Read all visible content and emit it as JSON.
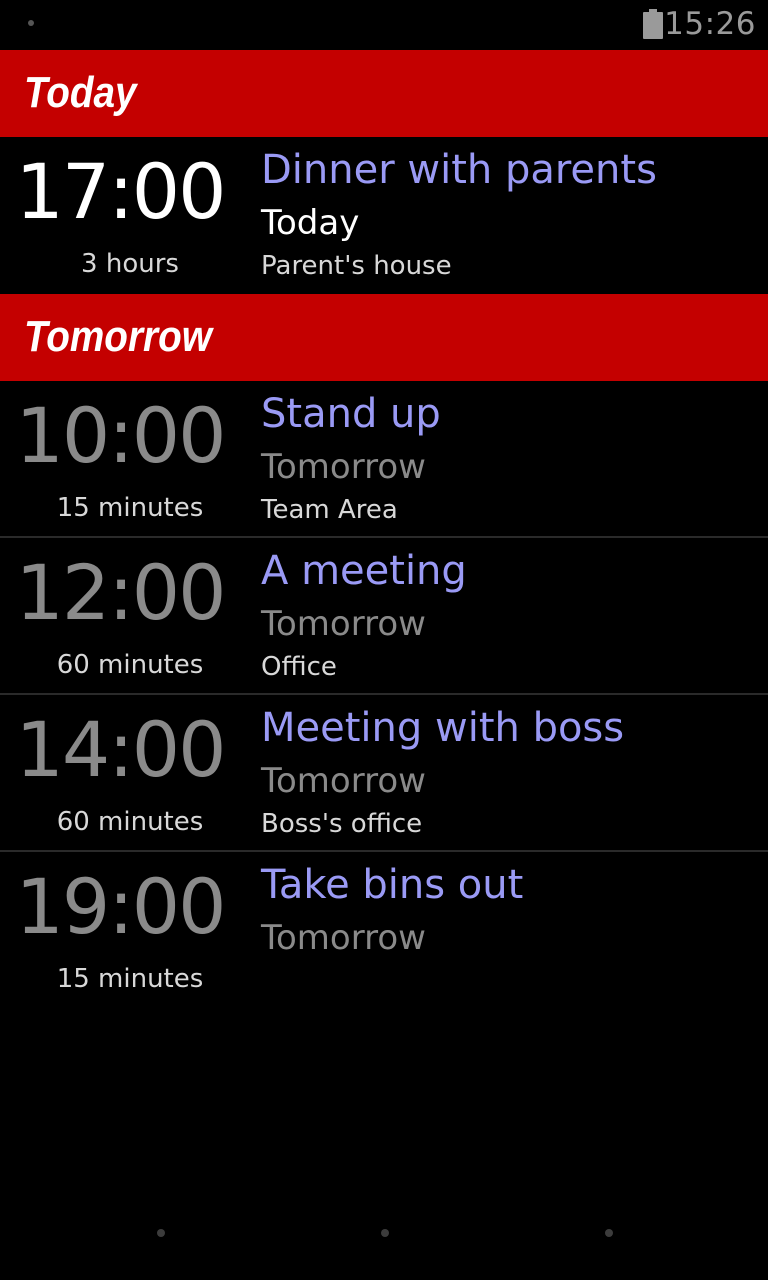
{
  "status_bar": {
    "time": "15:26",
    "battery_icon": "battery-icon"
  },
  "sections": [
    {
      "label": "Today",
      "events": [
        {
          "time": "17:00",
          "duration": "3 hours",
          "title": "Dinner with parents",
          "day": "Today",
          "location": "Parent's house"
        }
      ]
    },
    {
      "label": "Tomorrow",
      "events": [
        {
          "time": "10:00",
          "duration": "15 minutes",
          "title": "Stand up",
          "day": "Tomorrow",
          "location": "Team Area"
        },
        {
          "time": "12:00",
          "duration": "60 minutes",
          "title": "A meeting",
          "day": "Tomorrow",
          "location": "Office"
        },
        {
          "time": "14:00",
          "duration": "60 minutes",
          "title": "Meeting with boss",
          "day": "Tomorrow",
          "location": "Boss's office"
        },
        {
          "time": "19:00",
          "duration": "15 minutes",
          "title": "Take bins out",
          "day": "Tomorrow",
          "location": ""
        }
      ]
    }
  ],
  "colors": {
    "header_background": "#c40000",
    "title_color": "#9a9af5",
    "background": "#000000"
  }
}
